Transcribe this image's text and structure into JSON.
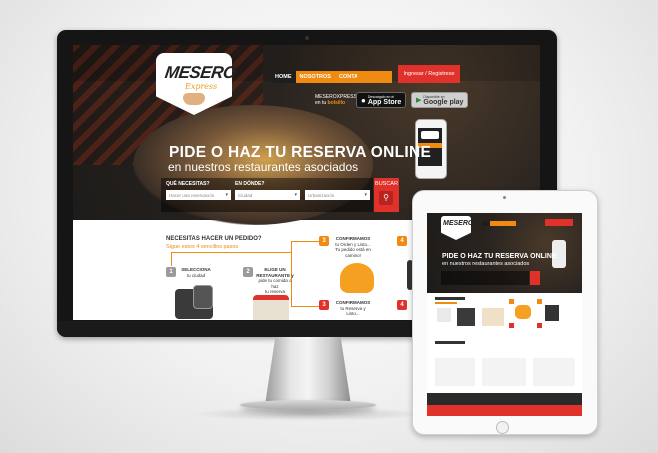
{
  "site": {
    "logo": {
      "main_a": "MESE",
      "main_b": "RO",
      "sub": "Express"
    },
    "nav": {
      "home": "HOME",
      "nosotros": "NOSOTROS",
      "contacto": "CONTACTO"
    },
    "login_label": "Ingresar / Registrese",
    "tagline": {
      "line1": "MESEROXPRESS",
      "line2_prefix": "en tu ",
      "line2_em": "bolsillo"
    },
    "app_store": {
      "top": "Descargalo en el",
      "bottom": "App Store"
    },
    "google_play": {
      "top": "Disponible en",
      "bottom": "Google play"
    },
    "headline": "PIDE O HAZ TU RESERVA ONLINE",
    "subheadline": "en nuestros restaurantes asociados",
    "search": {
      "need_label": "QUÉ NECESITAS?",
      "need_value": "Hacer una reservación",
      "where_label": "EN DÓNDE?",
      "city_value": "Ciudad",
      "area_value": "Urbanización",
      "submit_label": "BUSCAR"
    },
    "steps": {
      "title": "NECESITAS HACER UN PEDIDO?",
      "subtitle": "Sigue estos 4 sencillos pasos",
      "items": [
        {
          "num": "1",
          "text_a": "SELECCIONA",
          "text_b": "tu ciudad"
        },
        {
          "num": "2",
          "text_a": "ELIGE UN",
          "text_b": "RESTAURANTE y",
          "text_c": "pide tu comida o haz",
          "text_d": "tu reserva"
        },
        {
          "num": "3",
          "text_a": "CONFIRMAMOS",
          "text_b": "tu Orden y Listo...",
          "text_c": "Tu pedido está en",
          "text_d": "camino!"
        },
        {
          "num": "3",
          "text_a": "CONFIRMAMOS",
          "text_b": "tu Reserva y",
          "text_c": "Listo..."
        },
        {
          "num": "4",
          "text_a": ""
        },
        {
          "num": "4",
          "text_a": ""
        }
      ]
    }
  },
  "ipad_site": {
    "logo": "MESERO",
    "headline": "PIDE O HAZ TU RESERVA ONLINE",
    "subheadline": "en nuestros restaurantes asociados"
  },
  "colors": {
    "brand_orange": "#f08a10",
    "brand_red": "#e0322b",
    "dark": "#1e1e1e"
  }
}
